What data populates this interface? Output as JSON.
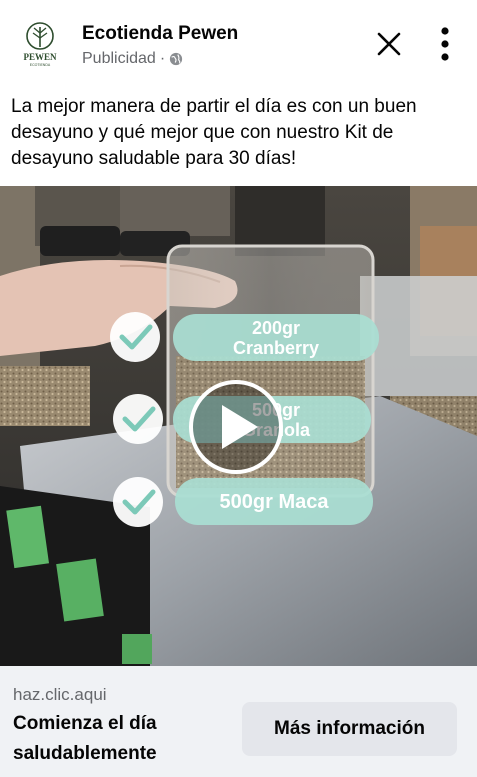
{
  "header": {
    "page_name": "Ecotienda Pewen",
    "sponsored_label": "Publicidad",
    "separator": "·",
    "avatar_text": "PEWEN",
    "avatar_subtext": "ECOTIENDA",
    "icons": {
      "close": "close-icon",
      "more": "more-vertical-icon",
      "globe": "globe-icon",
      "logo": "tree-logo-icon"
    }
  },
  "post": {
    "text": "La mejor manera de partir el día es con un buen desayuno y qué mejor que con nuestro Kit de desayuno saludable para 30 días!"
  },
  "video": {
    "checklist": [
      {
        "line1": "200gr",
        "line2": "Cranberry"
      },
      {
        "line1": "500gr",
        "line2": "Granola"
      },
      {
        "line1": "500gr Maca",
        "line2": ""
      }
    ],
    "play_icon": "play-icon",
    "check_icon": "check-icon"
  },
  "cta": {
    "domain": "haz.clic.aqui",
    "headline": "Comienza el día saludablemente",
    "button_label": "Más información"
  },
  "colors": {
    "pill": "#a9ded3",
    "pill_text": "#ffffff",
    "check": "#7cc9b8",
    "cta_bg": "#f0f2f5",
    "button_bg": "#e4e6eb",
    "secondary_text": "#65676b"
  }
}
